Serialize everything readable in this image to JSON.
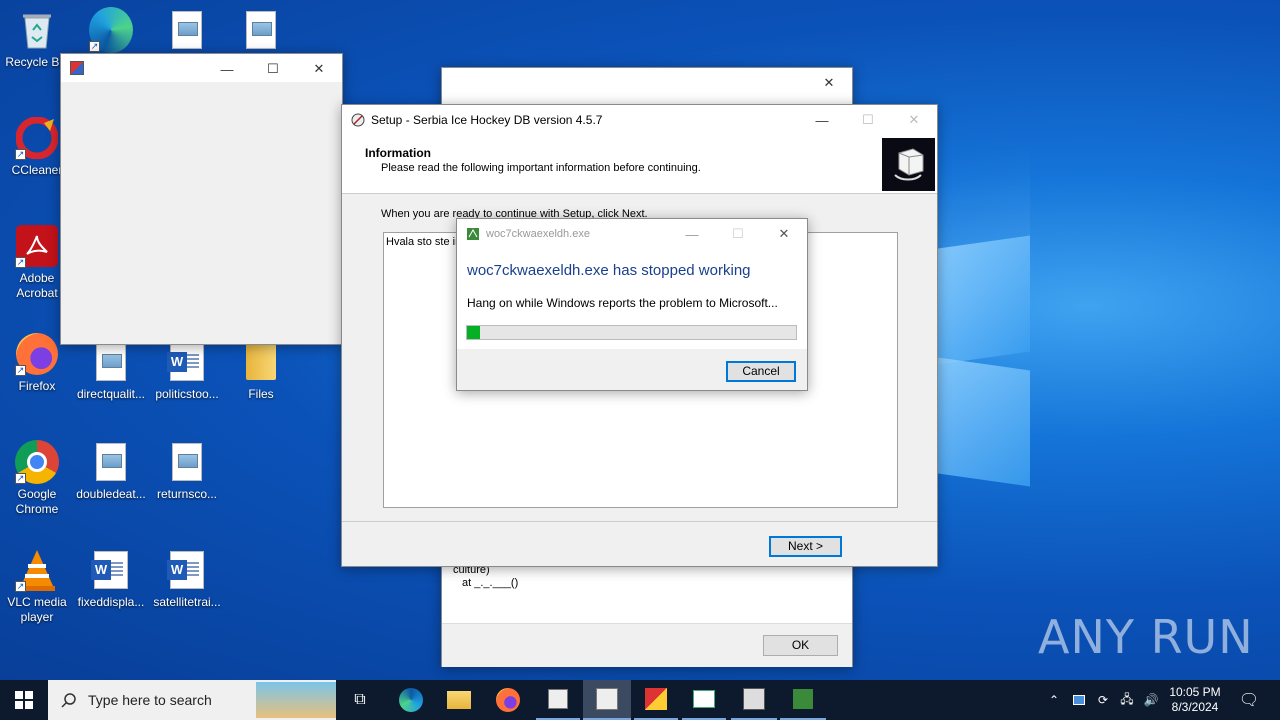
{
  "desktop_icons": [
    {
      "label": "Recycle Bin",
      "icon": "recycle-bin-icon"
    },
    {
      "label": "CCleaner",
      "icon": "ccleaner-icon"
    },
    {
      "label": "Adobe Acrobat",
      "icon": "adobe-acrobat-icon"
    },
    {
      "label": "Firefox",
      "icon": "firefox-icon"
    },
    {
      "label": "directqualit...",
      "icon": "image-file-icon"
    },
    {
      "label": "politicstoo...",
      "icon": "word-document-icon"
    },
    {
      "label": "Files",
      "icon": "folder-icon"
    },
    {
      "label": "Google Chrome",
      "icon": "chrome-icon"
    },
    {
      "label": "doubledeat...",
      "icon": "image-file-icon"
    },
    {
      "label": "returnsco...",
      "icon": "image-file-icon"
    },
    {
      "label": "VLC media player",
      "icon": "vlc-icon"
    },
    {
      "label": "fixeddispla...",
      "icon": "word-document-icon"
    },
    {
      "label": "satellitetrai...",
      "icon": "word-document-icon"
    }
  ],
  "error_window": {
    "text_line1": "culture)",
    "text_line2": "at _._.___()",
    "ok_label": "OK"
  },
  "setup": {
    "title": "Setup - Serbia Ice Hockey DB version 4.5.7",
    "heading": "Information",
    "subheading": "Please read the following important information before continuing.",
    "instruction": "When you are ready to continue with Setup, click Next.",
    "memo_text": "Hvala sto ste in",
    "next_label": "Next >"
  },
  "crash": {
    "title": "woc7ckwaexeldh.exe",
    "heading": "woc7ckwaexeldh.exe has stopped working",
    "message": "Hang on while Windows reports the problem to Microsoft...",
    "progress_fraction": 0.04,
    "cancel_label": "Cancel"
  },
  "taskbar": {
    "search_placeholder": "Type here to search",
    "time": "10:05 PM",
    "date": "8/3/2024"
  },
  "watermark": "ANY RUN",
  "colors": {
    "accent": "#0078d7",
    "crash_heading": "#1a3f8f",
    "progress": "#06b025",
    "taskbar": "#0d1a2e"
  }
}
